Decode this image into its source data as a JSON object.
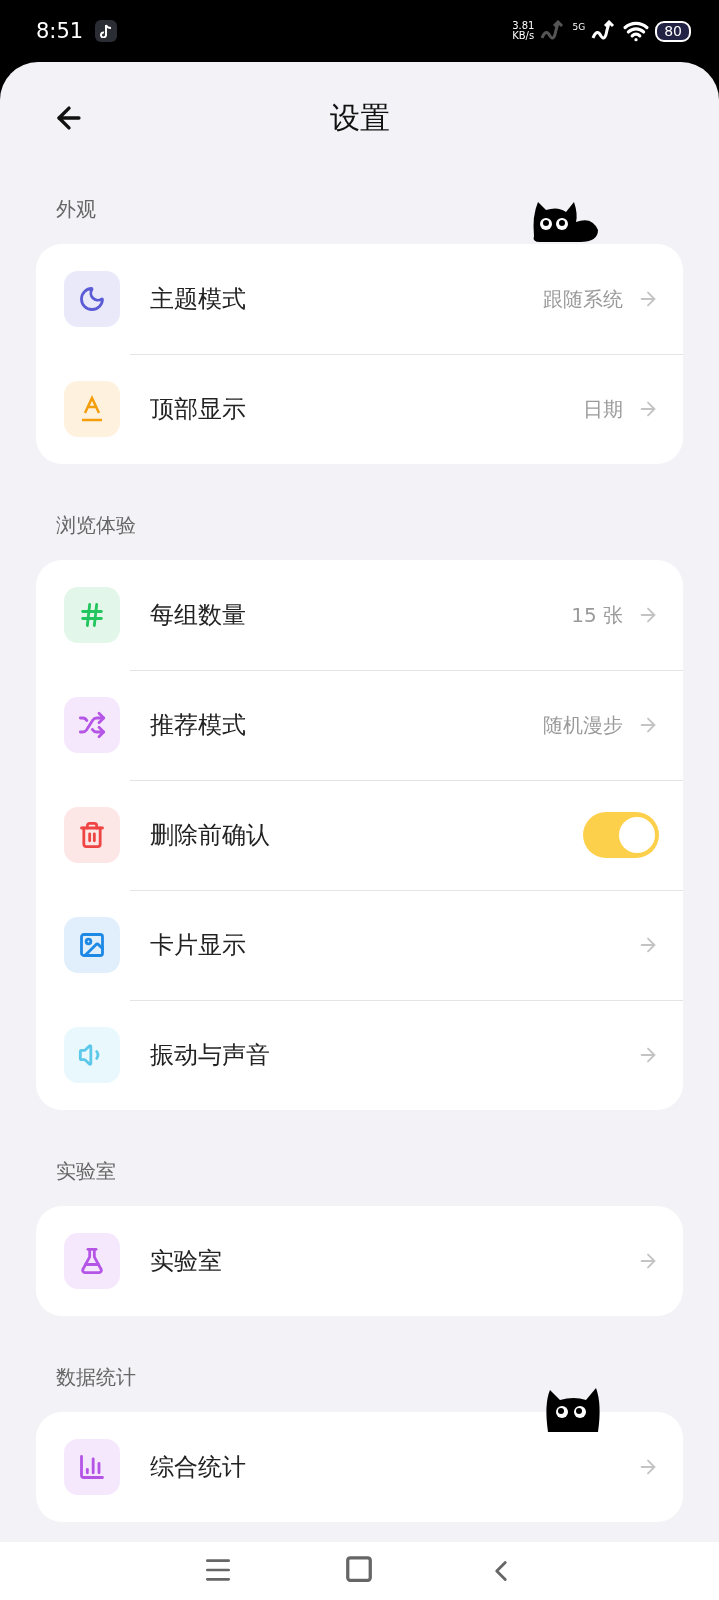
{
  "status_bar": {
    "time": "8:51",
    "speed_value": "3.81",
    "speed_unit": "KB/s",
    "network": "5G",
    "battery": "80"
  },
  "header": {
    "title": "设置"
  },
  "sections": [
    {
      "title": "外观",
      "items": [
        {
          "label": "主题模式",
          "value": "跟随系统",
          "kind": "link",
          "color": "#5b5bd6"
        },
        {
          "label": "顶部显示",
          "value": "日期",
          "kind": "link",
          "color": "#f59e0b"
        }
      ]
    },
    {
      "title": "浏览体验",
      "items": [
        {
          "label": "每组数量",
          "value": "15 张",
          "kind": "link",
          "color": "#22c55e"
        },
        {
          "label": "推荐模式",
          "value": "随机漫步",
          "kind": "link",
          "color": "#b455e6"
        },
        {
          "label": "删除前确认",
          "kind": "toggle",
          "on": true,
          "color": "#ef4444"
        },
        {
          "label": "卡片显示",
          "kind": "link",
          "color": "#1e88e5"
        },
        {
          "label": "振动与声音",
          "kind": "link",
          "color": "#5cc8ea"
        }
      ]
    },
    {
      "title": "实验室",
      "items": [
        {
          "label": "实验室",
          "kind": "link",
          "color": "#b455e6"
        }
      ]
    },
    {
      "title": "数据统计",
      "items": [
        {
          "label": "综合统计",
          "kind": "link",
          "color": "#b455e6"
        }
      ]
    }
  ]
}
